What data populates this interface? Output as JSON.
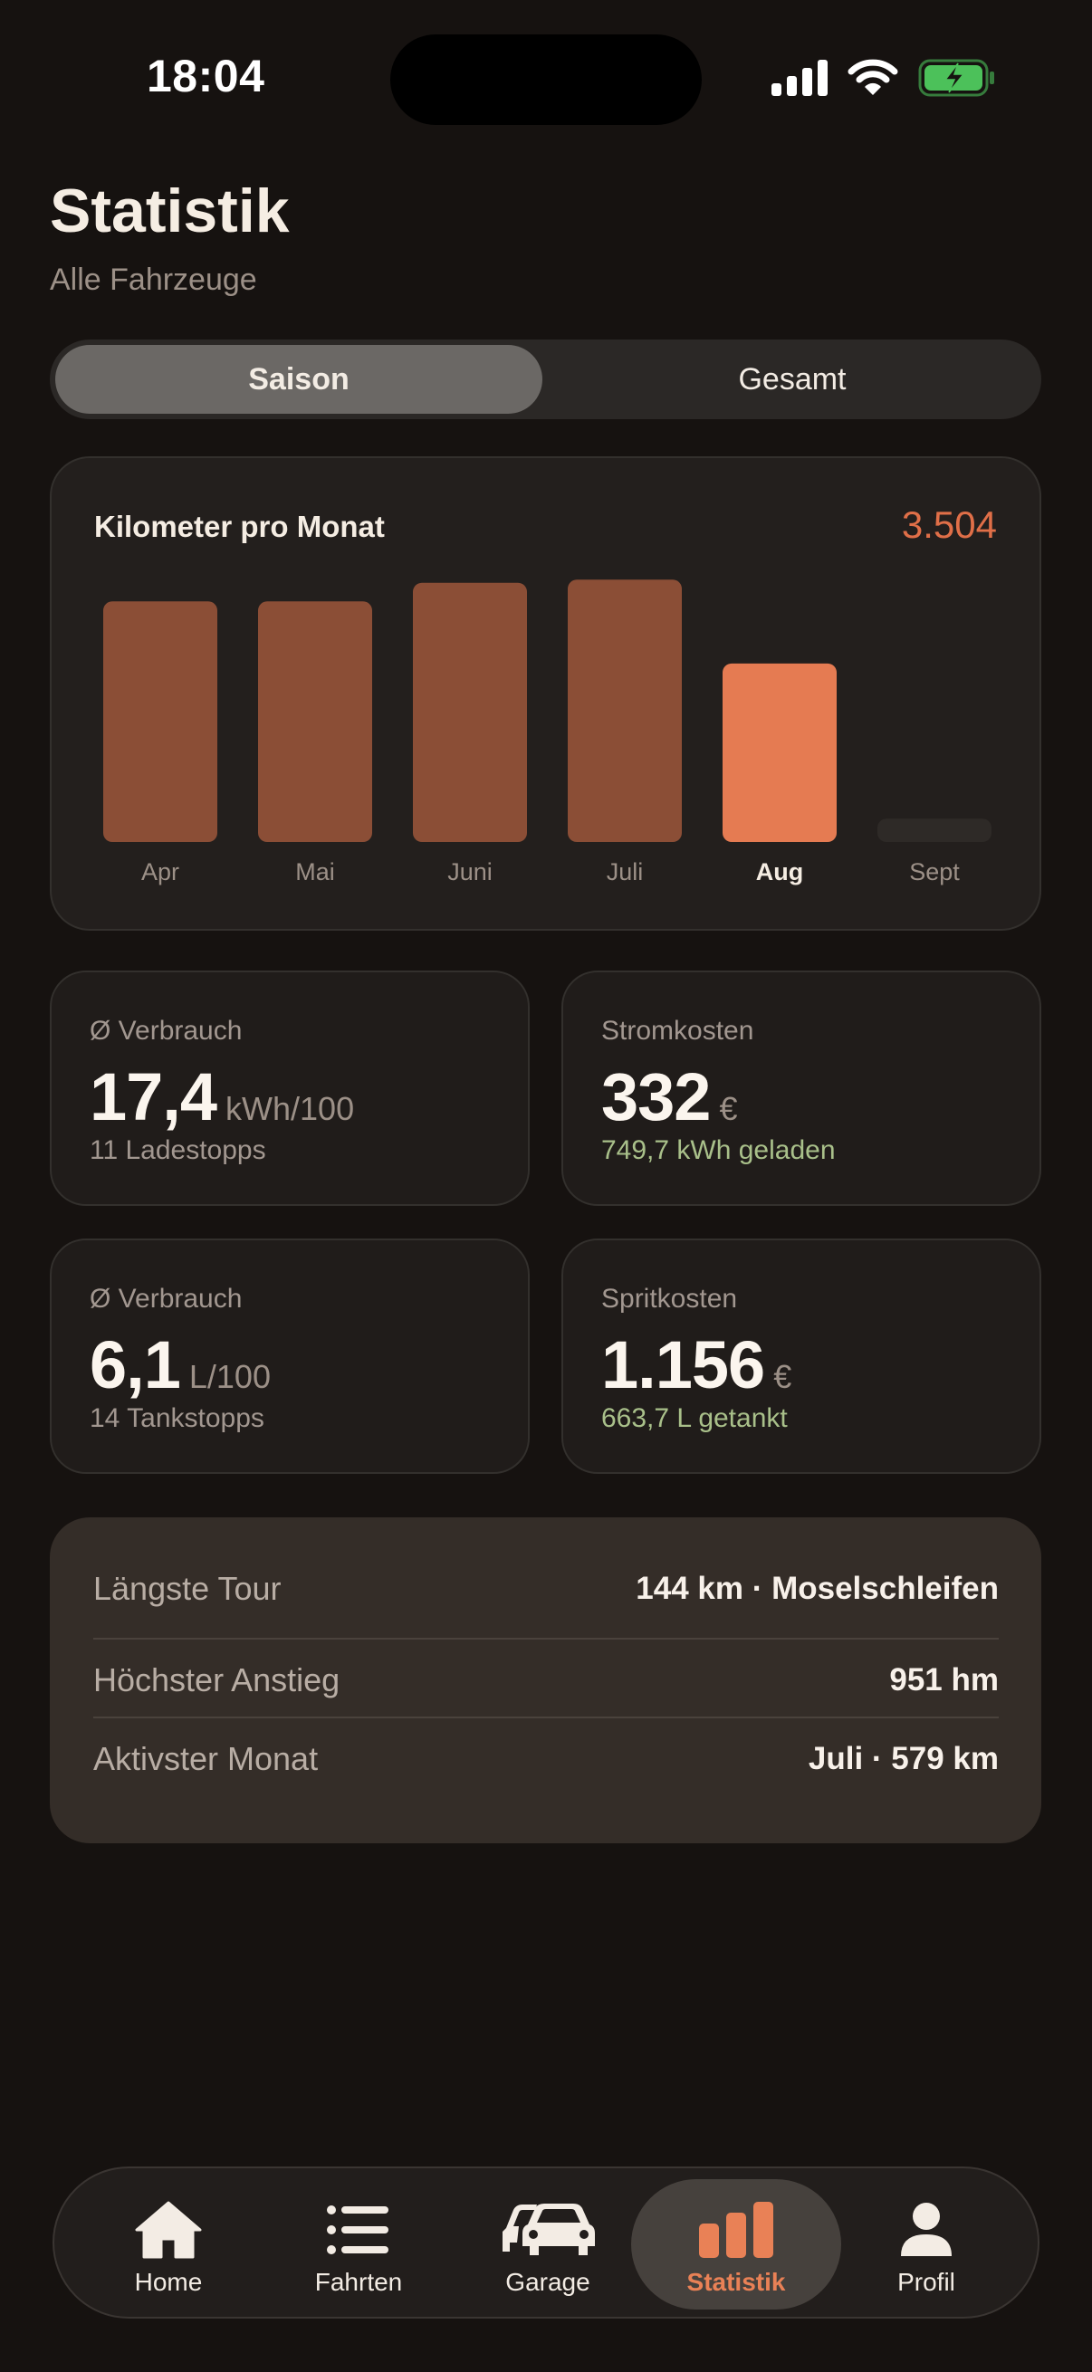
{
  "status_bar": {
    "time": "18:04",
    "icons": [
      "cellular-signal-icon",
      "wifi-icon",
      "battery-charging-icon"
    ],
    "battery_color": "#4cc15a"
  },
  "header": {
    "title": "Statistik",
    "subtitle": "Alle Fahrzeuge"
  },
  "segments": {
    "items": [
      "Saison",
      "Gesamt"
    ],
    "selected": "Saison"
  },
  "chart_card": {
    "title": "Kilometer pro Monat",
    "total": "3.504"
  },
  "chart_data": {
    "type": "bar",
    "categories": [
      "Apr",
      "Mai",
      "Juni",
      "Juli",
      "Aug",
      "Sept"
    ],
    "values": [
      620,
      620,
      668,
      676,
      460,
      60
    ],
    "highlighted": "Aug",
    "ylim": [
      0,
      700
    ],
    "grid": false,
    "legend": "none",
    "colors": {
      "bar": "#8b4e36",
      "highlight": "#e57b52",
      "empty": "#2e2a27"
    }
  },
  "stats": {
    "ev_consumption": {
      "label": "Ø Verbrauch",
      "value": "17,4",
      "unit": "kWh/100",
      "sub": "11 Ladestopps"
    },
    "electricity_cost": {
      "label": "Stromkosten",
      "value": "332",
      "unit": "€",
      "sub": "749,7 kWh geladen"
    },
    "fuel_consumption": {
      "label": "Ø Verbrauch",
      "value": "6,1",
      "unit": "L/100",
      "sub": "14 Tankstopps"
    },
    "fuel_cost": {
      "label": "Spritkosten",
      "value": "1.156",
      "unit": "€",
      "sub": "663,7 L getankt"
    }
  },
  "records": [
    {
      "label": "Längste Tour",
      "value": "144 km · Moselschleifen"
    },
    {
      "label": "Höchster Anstieg",
      "value": "951 hm"
    },
    {
      "label": "Aktivster Monat",
      "value": "Juli · 579 km"
    }
  ],
  "tab_bar": {
    "items": [
      {
        "label": "Home",
        "icon": "home-icon"
      },
      {
        "label": "Fahrten",
        "icon": "list-icon"
      },
      {
        "label": "Garage",
        "icon": "cars-icon"
      },
      {
        "label": "Statistik",
        "icon": "bar-chart-icon"
      },
      {
        "label": "Profil",
        "icon": "person-icon"
      }
    ],
    "active": "Statistik",
    "active_color": "#e98156"
  }
}
